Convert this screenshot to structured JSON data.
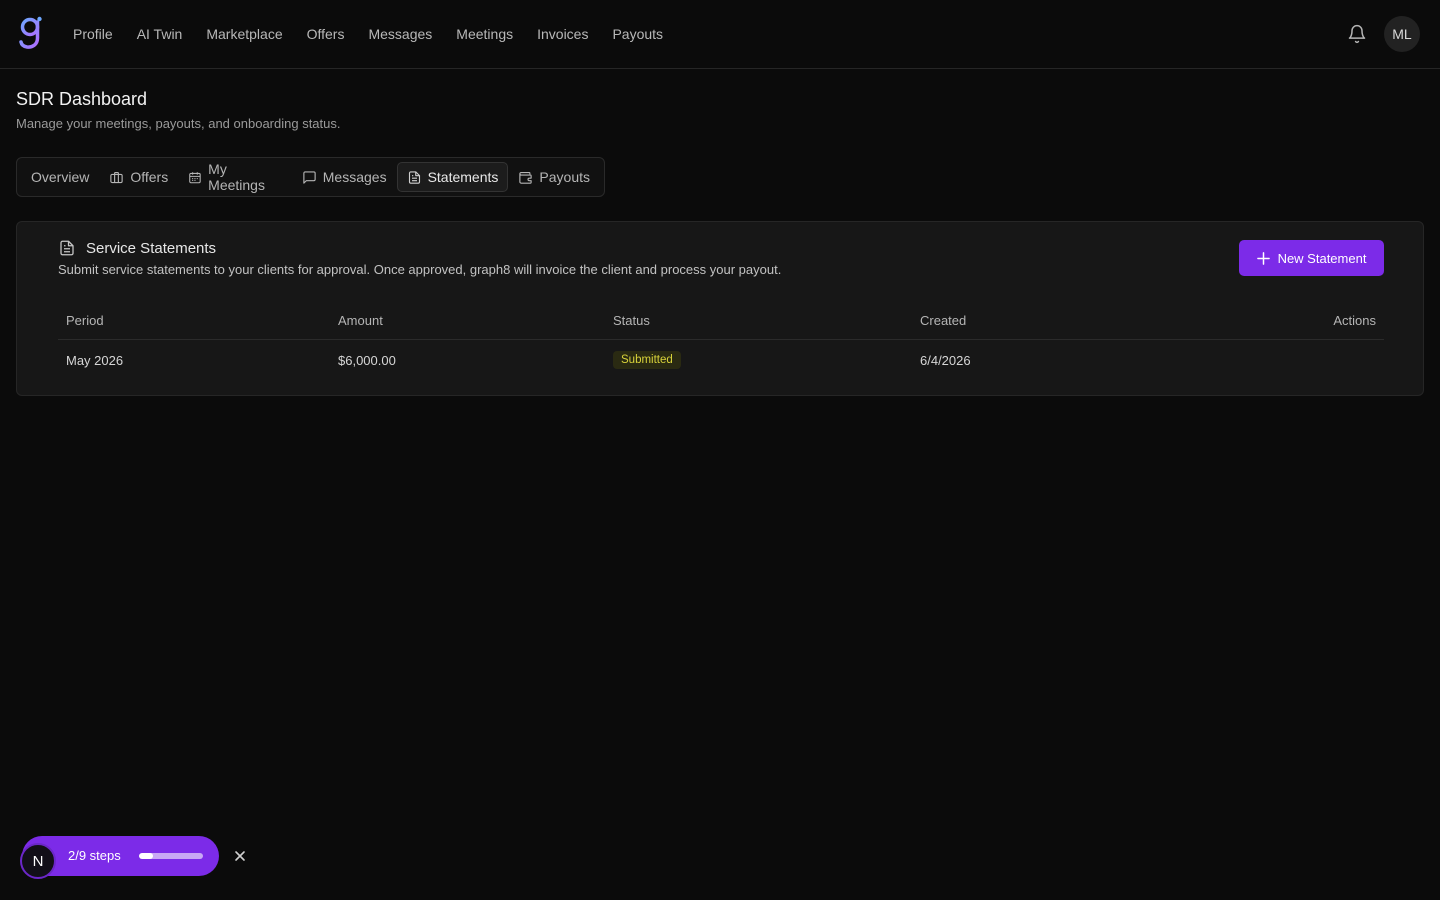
{
  "nav": {
    "items": [
      "Profile",
      "AI Twin",
      "Marketplace",
      "Offers",
      "Messages",
      "Meetings",
      "Invoices",
      "Payouts"
    ],
    "avatar_initials": "ML"
  },
  "header": {
    "title": "SDR Dashboard",
    "subtitle": "Manage your meetings, payouts, and onboarding status."
  },
  "tabs": [
    {
      "label": "Overview",
      "icon": "none"
    },
    {
      "label": "Offers",
      "icon": "briefcase-icon"
    },
    {
      "label": "My Meetings",
      "icon": "calendar-icon"
    },
    {
      "label": "Messages",
      "icon": "message-icon"
    },
    {
      "label": "Statements",
      "icon": "file-text-icon",
      "active": true
    },
    {
      "label": "Payouts",
      "icon": "wallet-icon"
    }
  ],
  "statements": {
    "title": "Service Statements",
    "description": "Submit service statements to your clients for approval. Once approved, graph8 will invoice the client and process your payout.",
    "new_button_label": "New Statement",
    "columns": {
      "period": "Period",
      "amount": "Amount",
      "status": "Status",
      "created": "Created",
      "actions": "Actions"
    },
    "rows": [
      {
        "period": "May 2026",
        "amount": "$6,000.00",
        "status": "Submitted",
        "created": "6/4/2026"
      }
    ]
  },
  "onboarding": {
    "avatar_letter": "N",
    "steps_text": "2/9 steps",
    "progress": 0.22
  },
  "colors": {
    "accent": "#7c2be8",
    "background": "#0b0b0b",
    "card": "#171717",
    "status_submitted": "#d8d23a"
  }
}
